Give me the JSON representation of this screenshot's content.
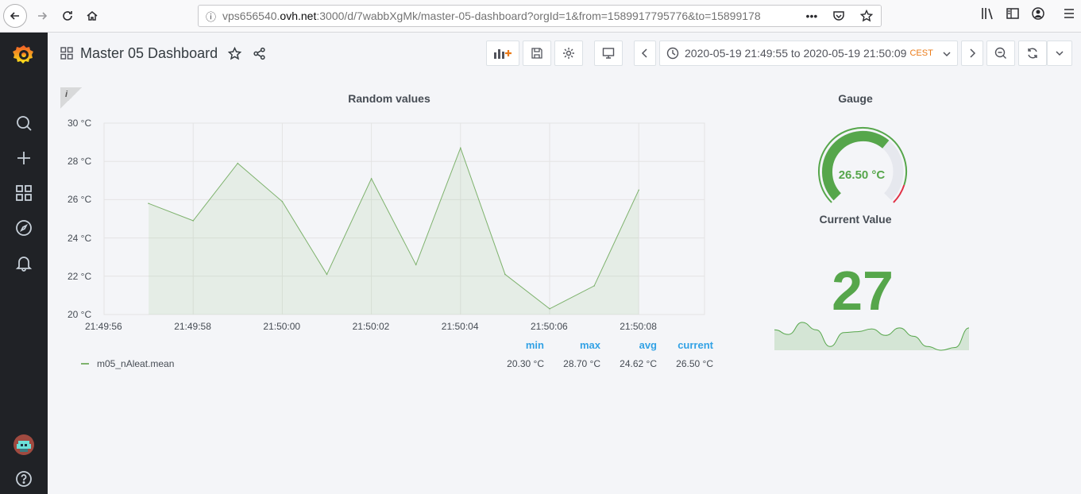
{
  "browser": {
    "url_prefix": "vps656540.",
    "url_host": "ovh.net",
    "url_rest": ":3000/d/7wabbXgMk/master-05-dashboard?orgId=1&from=1589917795776&to=15899178"
  },
  "dashboard": {
    "title": "Master 05 Dashboard",
    "time_range": "2020-05-19 21:49:55 to 2020-05-19 21:50:09",
    "timezone": "CEST"
  },
  "graph_panel": {
    "title": "Random values",
    "info_glyph": "i",
    "legend_headers": [
      "min",
      "max",
      "avg",
      "current"
    ],
    "series_name": "m05_nAleat.mean",
    "legend_values": [
      "20.30 °C",
      "28.70 °C",
      "24.62 °C",
      "26.50 °C"
    ]
  },
  "gauge_panel": {
    "title": "Gauge",
    "value_text": "26.50 °C",
    "value": 26.5,
    "min": 20,
    "max": 30,
    "threshold": 29
  },
  "stat_panel": {
    "title": "Current Value",
    "value_text": "27",
    "sparkline": [
      27,
      26.5,
      27.8,
      27,
      25.2,
      26.7,
      26.8,
      27.1,
      26.4,
      27.2,
      26.3,
      25.2,
      24.8,
      25.1,
      27.2
    ]
  },
  "chart_data": {
    "type": "line",
    "x": [
      "21:49:57",
      "21:49:58",
      "21:49:59",
      "21:50:00",
      "21:50:01",
      "21:50:02",
      "21:50:03",
      "21:50:04",
      "21:50:05",
      "21:50:06",
      "21:50:07",
      "21:50:08"
    ],
    "series": [
      {
        "name": "m05_nAleat.mean",
        "values": [
          25.8,
          24.9,
          27.9,
          25.9,
          22.1,
          27.1,
          22.6,
          28.7,
          22.1,
          20.3,
          21.5,
          26.5
        ]
      }
    ],
    "x_ticks": [
      "21:49:56",
      "21:49:58",
      "21:50:00",
      "21:50:02",
      "21:50:04",
      "21:50:06",
      "21:50:08"
    ],
    "y_ticks": [
      "30 °C",
      "28 °C",
      "26 °C",
      "24 °C",
      "22 °C",
      "20 °C"
    ],
    "ylim": [
      20,
      30
    ],
    "grid": true,
    "colors": {
      "line": "#7eb26d",
      "fill": "#7eb26d"
    }
  },
  "colors": {
    "accent_green": "#56a64b",
    "grafana_orange": "#eb7b18",
    "legend_blue": "#33a2e5"
  }
}
